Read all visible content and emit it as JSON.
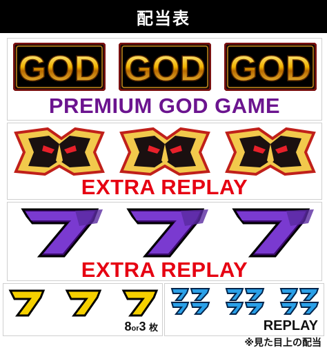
{
  "header": {
    "title": "配当表"
  },
  "sections": [
    {
      "symbol": "god-logo",
      "label": "PREMIUM GOD GAME",
      "label_color": "#6b148f"
    },
    {
      "symbol": "demon-mask",
      "label": "EXTRA REPLAY",
      "label_color": "#e60012"
    },
    {
      "symbol": "purple-seven",
      "label": "EXTRA REPLAY",
      "label_color": "#e60012"
    }
  ],
  "bottom_left": {
    "symbol": "yellow-seven",
    "payout_num1": "8",
    "payout_or": "or",
    "payout_num2": "3",
    "payout_unit": "枚"
  },
  "bottom_right": {
    "symbol": "blue-double-seven",
    "label": "REPLAY"
  },
  "footnote": "※見た目上の配当"
}
